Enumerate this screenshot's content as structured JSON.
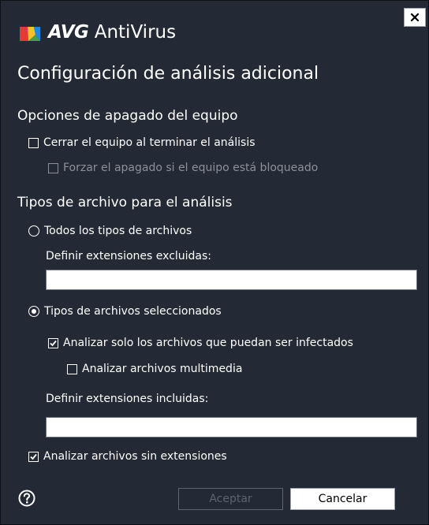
{
  "window": {
    "brand_bold": "AVG",
    "brand_rest": " AntiVirus",
    "close_label": "×"
  },
  "page_title": "Configuración de análisis adicional",
  "shutdown_section": {
    "title": "Opciones de apagado del equipo",
    "options": [
      {
        "label": "Cerrar el equipo al terminar el análisis",
        "checked": false,
        "enabled": true
      },
      {
        "label": "Forzar el apagado si el equipo está bloqueado",
        "checked": false,
        "enabled": false
      }
    ]
  },
  "filetypes_section": {
    "title": "Tipos de archivo para el análisis",
    "all_types_radio": {
      "label": "Todos los tipos de archivos",
      "selected": false
    },
    "excluded_label": "Definir extensiones excluidas:",
    "excluded_value": "",
    "selected_types_radio": {
      "label": "Tipos de archivos seleccionados",
      "selected": true
    },
    "infectable_only": {
      "label": "Analizar solo los archivos que puedan ser infectados",
      "checked": true
    },
    "multimedia": {
      "label": "Analizar archivos multimedia",
      "checked": false
    },
    "included_label": "Definir extensiones incluidas:",
    "included_value": "",
    "no_extension": {
      "label": "Analizar archivos sin extensiones",
      "checked": true
    }
  },
  "footer": {
    "accept_label": "Aceptar",
    "cancel_label": "Cancelar"
  },
  "colors": {
    "background": "#232a35",
    "text": "#ffffff",
    "disabled_text": "#8b9099"
  }
}
